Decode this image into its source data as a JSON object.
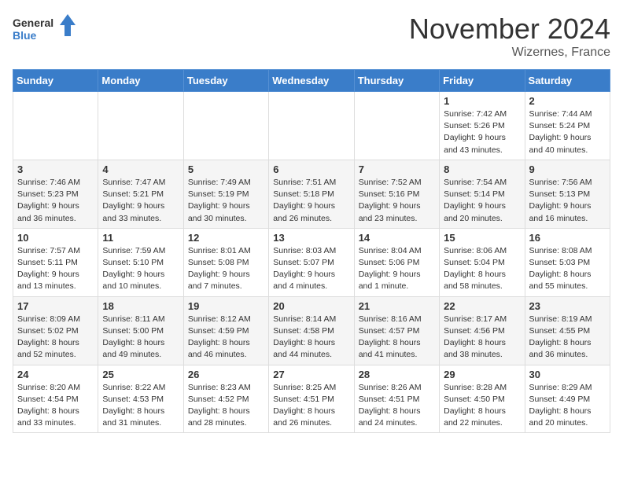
{
  "logo": {
    "text_general": "General",
    "text_blue": "Blue"
  },
  "title": {
    "month": "November 2024",
    "location": "Wizernes, France"
  },
  "weekdays": [
    "Sunday",
    "Monday",
    "Tuesday",
    "Wednesday",
    "Thursday",
    "Friday",
    "Saturday"
  ],
  "weeks": [
    [
      {
        "day": "",
        "info": ""
      },
      {
        "day": "",
        "info": ""
      },
      {
        "day": "",
        "info": ""
      },
      {
        "day": "",
        "info": ""
      },
      {
        "day": "",
        "info": ""
      },
      {
        "day": "1",
        "info": "Sunrise: 7:42 AM\nSunset: 5:26 PM\nDaylight: 9 hours\nand 43 minutes."
      },
      {
        "day": "2",
        "info": "Sunrise: 7:44 AM\nSunset: 5:24 PM\nDaylight: 9 hours\nand 40 minutes."
      }
    ],
    [
      {
        "day": "3",
        "info": "Sunrise: 7:46 AM\nSunset: 5:23 PM\nDaylight: 9 hours\nand 36 minutes."
      },
      {
        "day": "4",
        "info": "Sunrise: 7:47 AM\nSunset: 5:21 PM\nDaylight: 9 hours\nand 33 minutes."
      },
      {
        "day": "5",
        "info": "Sunrise: 7:49 AM\nSunset: 5:19 PM\nDaylight: 9 hours\nand 30 minutes."
      },
      {
        "day": "6",
        "info": "Sunrise: 7:51 AM\nSunset: 5:18 PM\nDaylight: 9 hours\nand 26 minutes."
      },
      {
        "day": "7",
        "info": "Sunrise: 7:52 AM\nSunset: 5:16 PM\nDaylight: 9 hours\nand 23 minutes."
      },
      {
        "day": "8",
        "info": "Sunrise: 7:54 AM\nSunset: 5:14 PM\nDaylight: 9 hours\nand 20 minutes."
      },
      {
        "day": "9",
        "info": "Sunrise: 7:56 AM\nSunset: 5:13 PM\nDaylight: 9 hours\nand 16 minutes."
      }
    ],
    [
      {
        "day": "10",
        "info": "Sunrise: 7:57 AM\nSunset: 5:11 PM\nDaylight: 9 hours\nand 13 minutes."
      },
      {
        "day": "11",
        "info": "Sunrise: 7:59 AM\nSunset: 5:10 PM\nDaylight: 9 hours\nand 10 minutes."
      },
      {
        "day": "12",
        "info": "Sunrise: 8:01 AM\nSunset: 5:08 PM\nDaylight: 9 hours\nand 7 minutes."
      },
      {
        "day": "13",
        "info": "Sunrise: 8:03 AM\nSunset: 5:07 PM\nDaylight: 9 hours\nand 4 minutes."
      },
      {
        "day": "14",
        "info": "Sunrise: 8:04 AM\nSunset: 5:06 PM\nDaylight: 9 hours\nand 1 minute."
      },
      {
        "day": "15",
        "info": "Sunrise: 8:06 AM\nSunset: 5:04 PM\nDaylight: 8 hours\nand 58 minutes."
      },
      {
        "day": "16",
        "info": "Sunrise: 8:08 AM\nSunset: 5:03 PM\nDaylight: 8 hours\nand 55 minutes."
      }
    ],
    [
      {
        "day": "17",
        "info": "Sunrise: 8:09 AM\nSunset: 5:02 PM\nDaylight: 8 hours\nand 52 minutes."
      },
      {
        "day": "18",
        "info": "Sunrise: 8:11 AM\nSunset: 5:00 PM\nDaylight: 8 hours\nand 49 minutes."
      },
      {
        "day": "19",
        "info": "Sunrise: 8:12 AM\nSunset: 4:59 PM\nDaylight: 8 hours\nand 46 minutes."
      },
      {
        "day": "20",
        "info": "Sunrise: 8:14 AM\nSunset: 4:58 PM\nDaylight: 8 hours\nand 44 minutes."
      },
      {
        "day": "21",
        "info": "Sunrise: 8:16 AM\nSunset: 4:57 PM\nDaylight: 8 hours\nand 41 minutes."
      },
      {
        "day": "22",
        "info": "Sunrise: 8:17 AM\nSunset: 4:56 PM\nDaylight: 8 hours\nand 38 minutes."
      },
      {
        "day": "23",
        "info": "Sunrise: 8:19 AM\nSunset: 4:55 PM\nDaylight: 8 hours\nand 36 minutes."
      }
    ],
    [
      {
        "day": "24",
        "info": "Sunrise: 8:20 AM\nSunset: 4:54 PM\nDaylight: 8 hours\nand 33 minutes."
      },
      {
        "day": "25",
        "info": "Sunrise: 8:22 AM\nSunset: 4:53 PM\nDaylight: 8 hours\nand 31 minutes."
      },
      {
        "day": "26",
        "info": "Sunrise: 8:23 AM\nSunset: 4:52 PM\nDaylight: 8 hours\nand 28 minutes."
      },
      {
        "day": "27",
        "info": "Sunrise: 8:25 AM\nSunset: 4:51 PM\nDaylight: 8 hours\nand 26 minutes."
      },
      {
        "day": "28",
        "info": "Sunrise: 8:26 AM\nSunset: 4:51 PM\nDaylight: 8 hours\nand 24 minutes."
      },
      {
        "day": "29",
        "info": "Sunrise: 8:28 AM\nSunset: 4:50 PM\nDaylight: 8 hours\nand 22 minutes."
      },
      {
        "day": "30",
        "info": "Sunrise: 8:29 AM\nSunset: 4:49 PM\nDaylight: 8 hours\nand 20 minutes."
      }
    ]
  ]
}
